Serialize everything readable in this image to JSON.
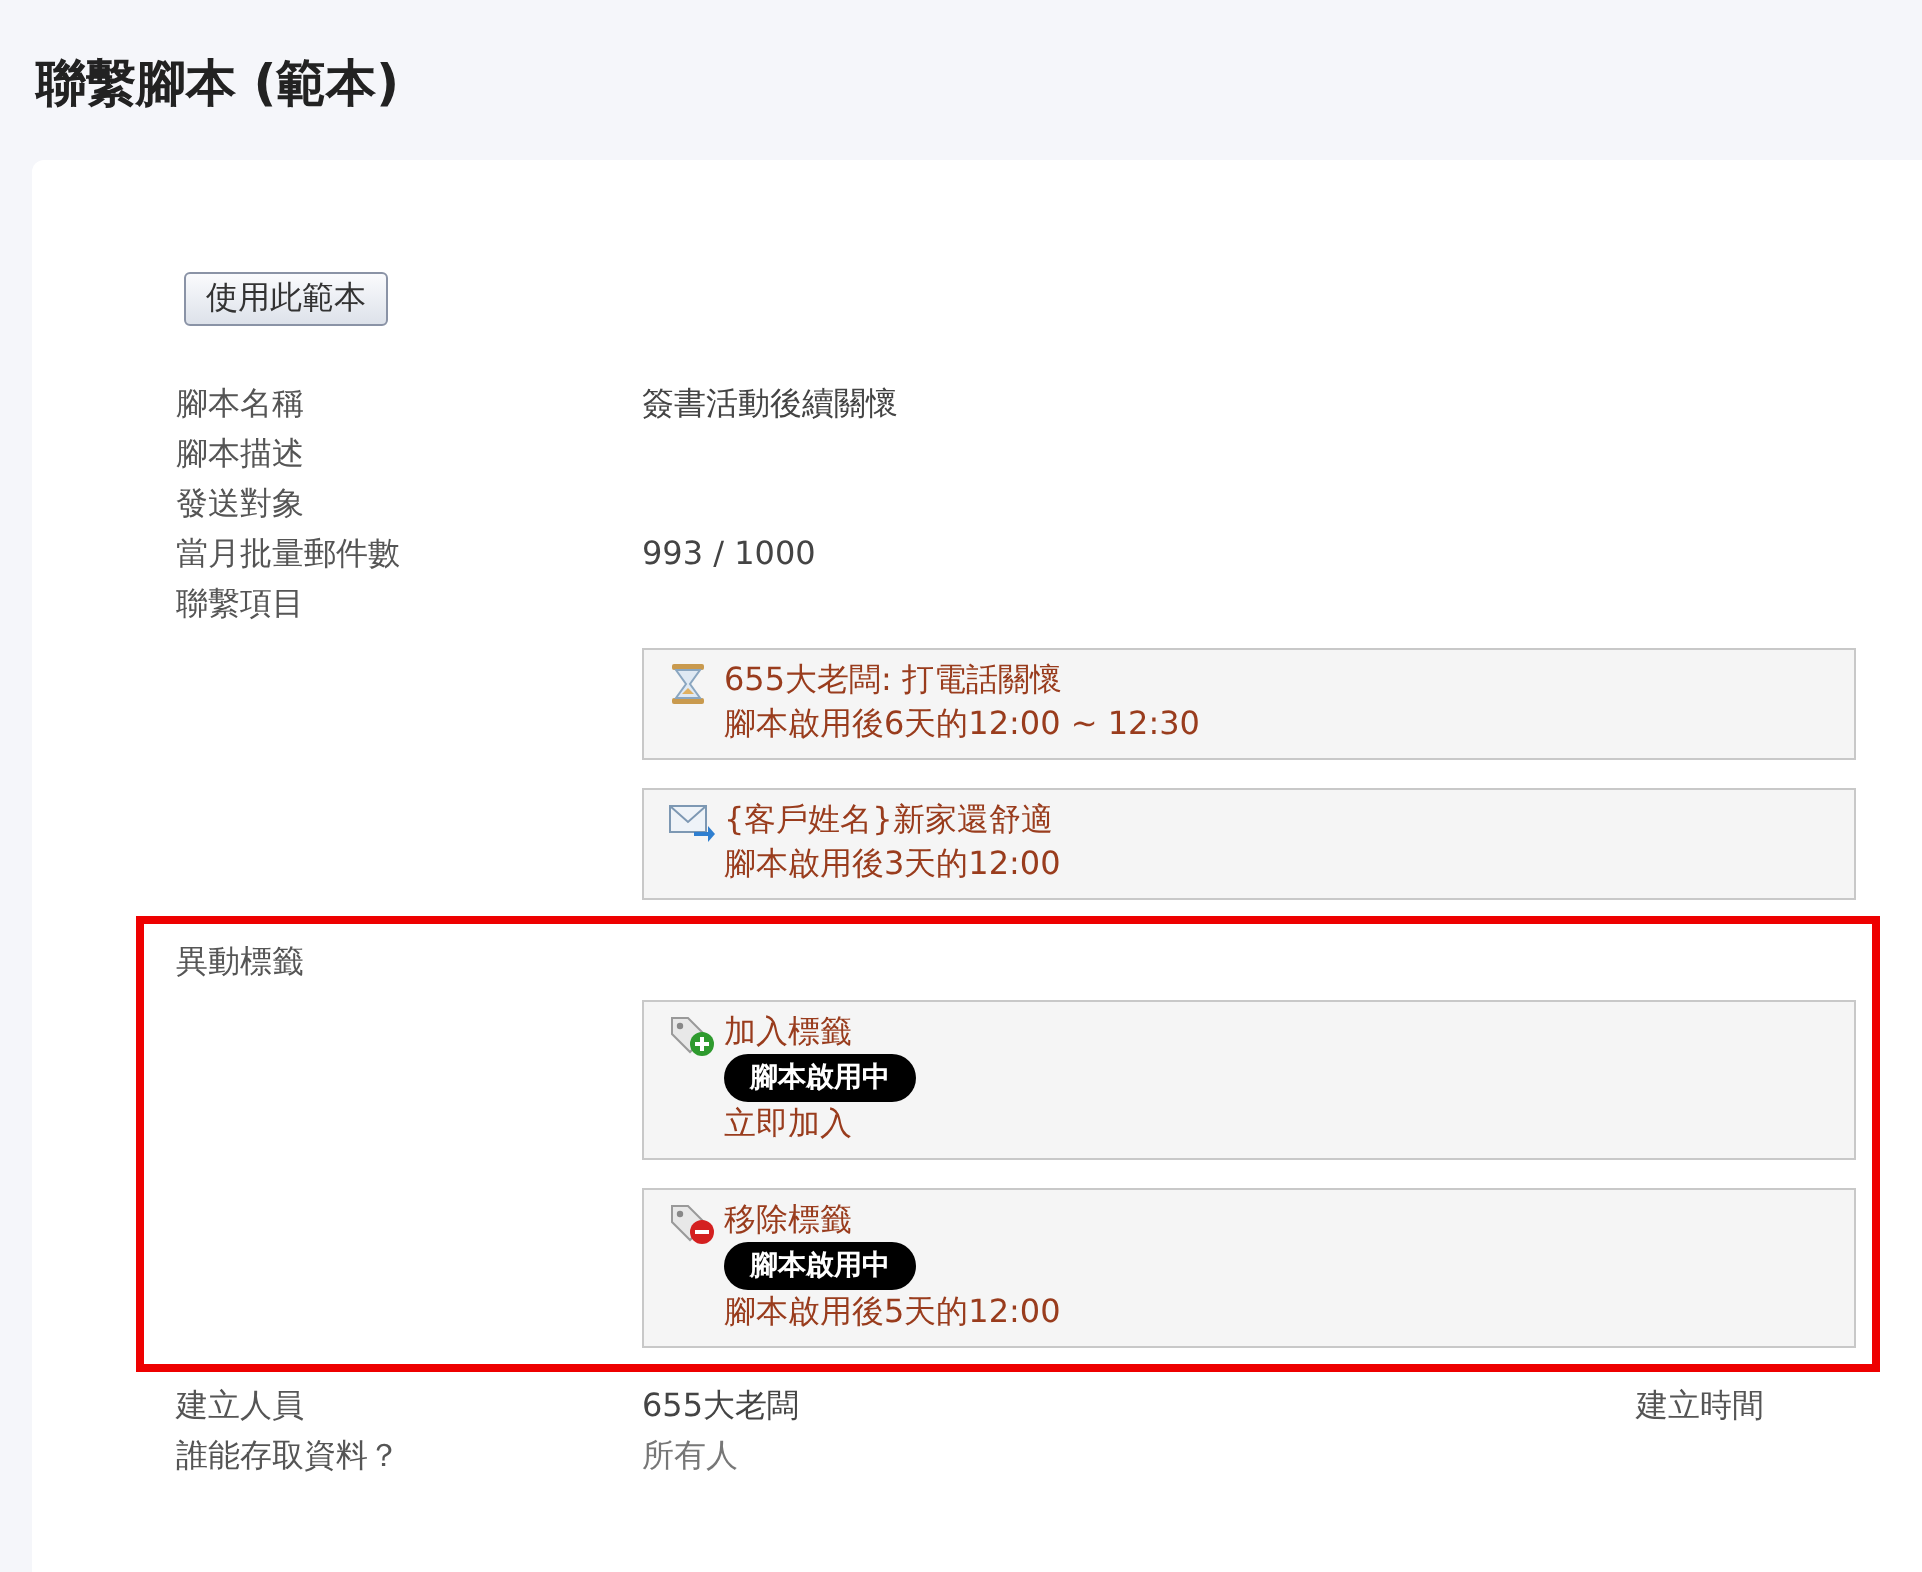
{
  "page_title": "聯繫腳本 (範本)",
  "use_template_button": "使用此範本",
  "fields": [
    {
      "label": "腳本名稱",
      "value": "簽書活動後續關懷"
    },
    {
      "label": "腳本描述"
    },
    {
      "label": "發送對象"
    },
    {
      "label": "當月批量郵件數",
      "value": "993 / 1000"
    }
  ],
  "contact_section": {
    "label": "聯繫項目",
    "items": [
      {
        "kind": "task",
        "title": "655大老闆: 打電話關懷",
        "schedule": "腳本啟用後6天的12:00 ~ 12:30"
      },
      {
        "kind": "email",
        "title": "{客戶姓名}新家還舒適",
        "schedule": "腳本啟用後3天的12:00"
      }
    ]
  },
  "tag_section": {
    "label": "異動標籤",
    "highlighted": true,
    "actions": [
      {
        "kind": "add",
        "title": "加入標籤",
        "badge": "腳本啟用中",
        "schedule": "立即加入"
      },
      {
        "kind": "remove",
        "title": "移除標籤",
        "badge": "腳本啟用中",
        "schedule": "腳本啟用後5天的12:00"
      }
    ]
  },
  "footer": [
    {
      "label": "建立人員",
      "value": "655大老闆",
      "muted": false,
      "side_label": "建立時間"
    },
    {
      "label": "誰能存取資料？",
      "value": "所有人",
      "muted": true
    }
  ]
}
